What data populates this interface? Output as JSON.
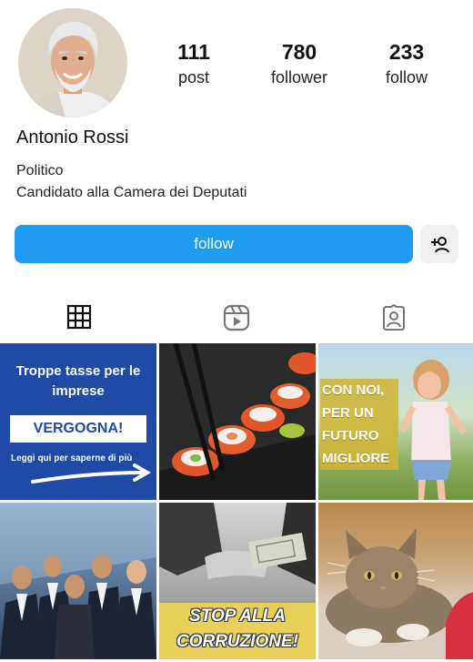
{
  "profile": {
    "name": "Antonio Rossi",
    "bio_line1": "Politico",
    "bio_line2": "Candidato alla Camera dei Deputati",
    "avatar_icon": "profile-photo"
  },
  "stats": {
    "posts": {
      "value": "111",
      "label": "post"
    },
    "followers": {
      "value": "780",
      "label": "follower"
    },
    "following": {
      "value": "233",
      "label": "follow"
    }
  },
  "actions": {
    "follow_label": "follow",
    "add_user_icon": "add-user-icon",
    "accent": "#1f9cf0"
  },
  "tabs": [
    {
      "icon": "grid-icon"
    },
    {
      "icon": "reels-icon"
    },
    {
      "icon": "tagged-icon"
    }
  ],
  "posts": {
    "p1": {
      "title": "Troppe tasse per le imprese",
      "box": "VERGOGNA!",
      "sub": "Leggi qui per saperne di più"
    },
    "p3": {
      "text": "CON NOI, PER UN FUTURO MIGLIORE"
    },
    "p5": {
      "line1": "STOP ALLA",
      "line2": "CORRUZIONE!"
    }
  }
}
